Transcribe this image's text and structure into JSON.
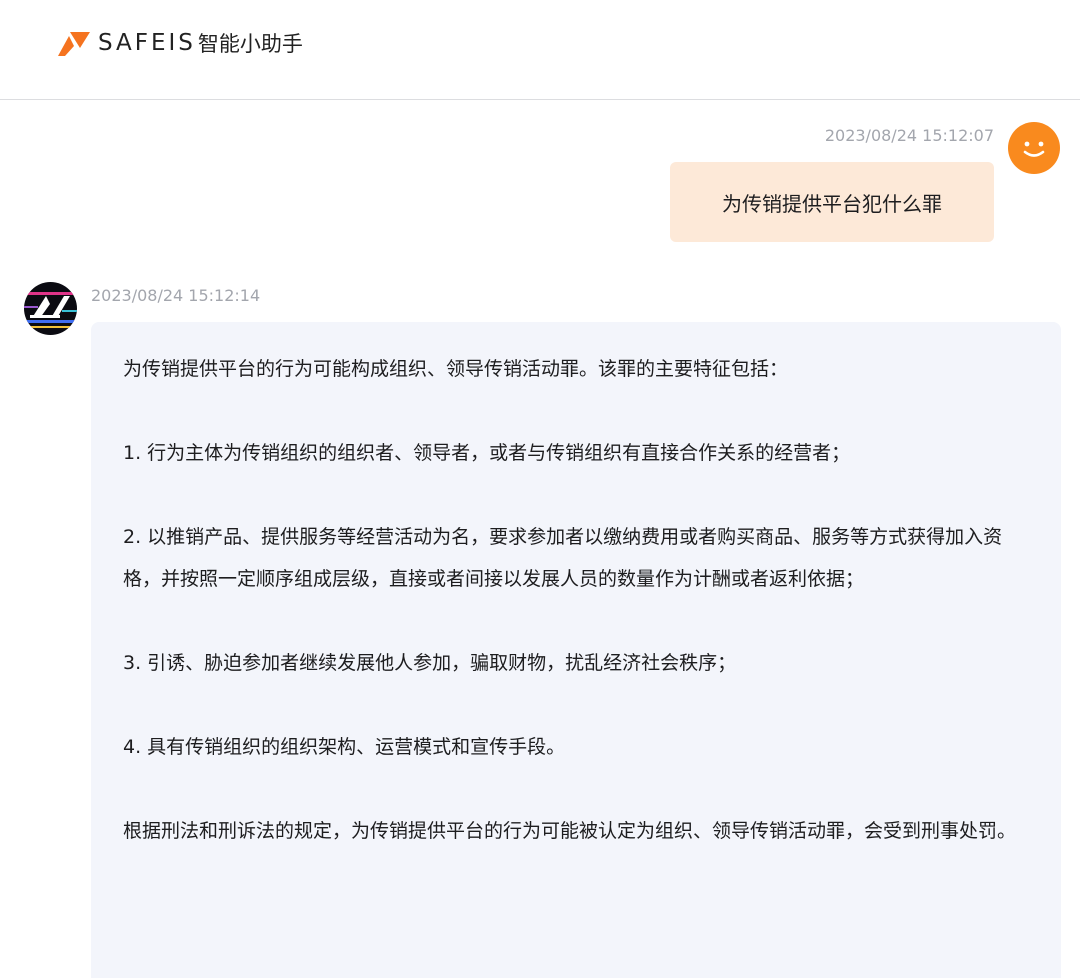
{
  "header": {
    "brand": "SAFEIS",
    "subtitle": "智能小助手"
  },
  "colors": {
    "accent": "#f5731f",
    "user_bubble": "#fde9d8",
    "bot_bubble": "#f3f5fb",
    "timestamp": "#a3a6ad"
  },
  "user_message": {
    "timestamp": "2023/08/24 15:12:07",
    "text": "为传销提供平台犯什么罪",
    "avatar_icon": "smiley-face-icon"
  },
  "bot_message": {
    "timestamp": "2023/08/24 15:12:14",
    "avatar_icon": "bot-logo-icon",
    "paragraphs": [
      "为传销提供平台的行为可能构成组织、领导传销活动罪。该罪的主要特征包括：",
      "1. 行为主体为传销组织的组织者、领导者，或者与传销组织有直接合作关系的经营者；",
      "2. 以推销产品、提供服务等经营活动为名，要求参加者以缴纳费用或者购买商品、服务等方式获得加入资格，并按照一定顺序组成层级，直接或者间接以发展人员的数量作为计酬或者返利依据；",
      "3. 引诱、胁迫参加者继续发展他人参加，骗取财物，扰乱经济社会秩序；",
      "4. 具有传销组织的组织架构、运营模式和宣传手段。",
      "根据刑法和刑诉法的规定，为传销提供平台的行为可能被认定为组织、领导传销活动罪，会受到刑事处罚。"
    ]
  }
}
